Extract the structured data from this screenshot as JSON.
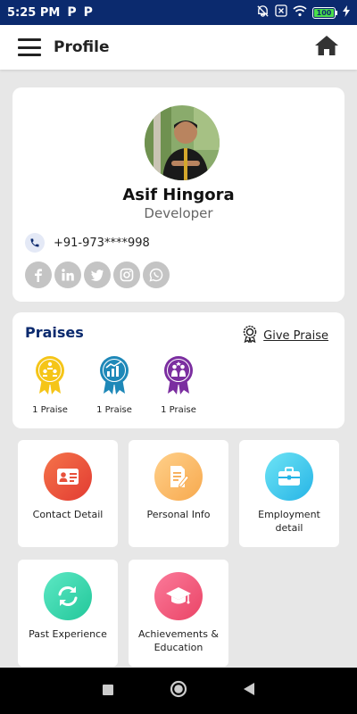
{
  "status_bar": {
    "time": "5:25 PM",
    "notif_glyph": "P",
    "battery_level": "100"
  },
  "app_bar": {
    "title": "Profile"
  },
  "profile": {
    "name": "Asif Hingora",
    "role": "Developer",
    "phone": "+91-973****998",
    "social": [
      "facebook-icon",
      "linkedin-icon",
      "twitter-icon",
      "instagram-icon",
      "whatsapp-icon"
    ]
  },
  "praises": {
    "title": "Praises",
    "give_label": "Give Praise",
    "badges": [
      {
        "count": "1 Praise",
        "color": "#f5c518"
      },
      {
        "count": "1 Praise",
        "color": "#1e88b8"
      },
      {
        "count": "1 Praise",
        "color": "#7b2ea0"
      }
    ]
  },
  "tiles": {
    "contact": {
      "label": "Contact Detail"
    },
    "personal": {
      "label": "Personal Info"
    },
    "employment": {
      "label": "Employment detail"
    },
    "past": {
      "label": "Past Experience"
    },
    "achievements": {
      "label": "Achievements & Education"
    }
  }
}
